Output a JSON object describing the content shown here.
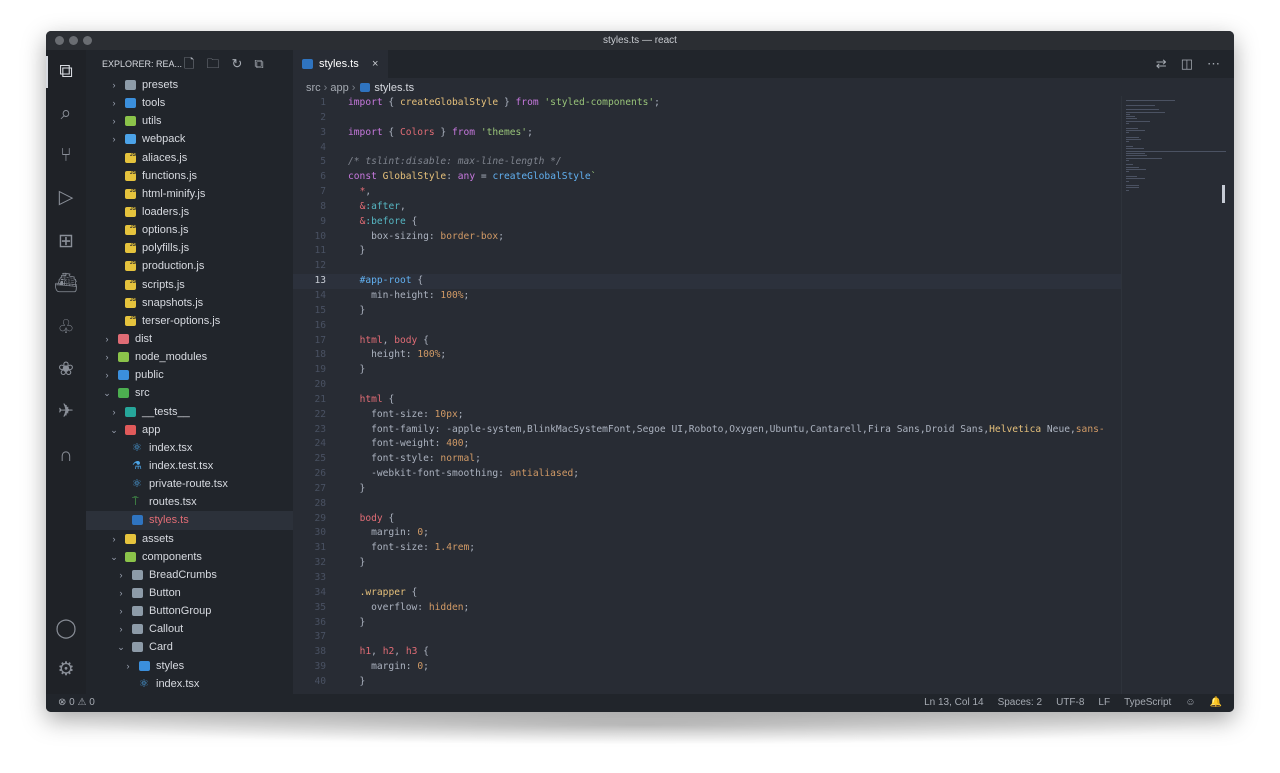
{
  "window": {
    "title": "styles.ts — react"
  },
  "explorer": {
    "title": "EXPLORER: REA...",
    "tree": [
      {
        "label": "presets",
        "kind": "folder",
        "indent": 1,
        "chev": ">",
        "color": "#8d9ba8"
      },
      {
        "label": "tools",
        "kind": "folder",
        "indent": 1,
        "chev": ">",
        "color": "#3b8fdc"
      },
      {
        "label": "utils",
        "kind": "folder",
        "indent": 1,
        "chev": ">",
        "color": "#8bc34a"
      },
      {
        "label": "webpack",
        "kind": "folder",
        "indent": 1,
        "chev": ">",
        "color": "#4ca3e8"
      },
      {
        "label": "aliaces.js",
        "kind": "js",
        "indent": 1
      },
      {
        "label": "functions.js",
        "kind": "js",
        "indent": 1
      },
      {
        "label": "html-minify.js",
        "kind": "js",
        "indent": 1
      },
      {
        "label": "loaders.js",
        "kind": "js",
        "indent": 1
      },
      {
        "label": "options.js",
        "kind": "js",
        "indent": 1
      },
      {
        "label": "polyfills.js",
        "kind": "js",
        "indent": 1
      },
      {
        "label": "production.js",
        "kind": "js",
        "indent": 1
      },
      {
        "label": "scripts.js",
        "kind": "js",
        "indent": 1
      },
      {
        "label": "snapshots.js",
        "kind": "js",
        "indent": 1
      },
      {
        "label": "terser-options.js",
        "kind": "js",
        "indent": 1
      },
      {
        "label": "dist",
        "kind": "folder",
        "indent": 0,
        "chev": ">",
        "color": "#e06c75"
      },
      {
        "label": "node_modules",
        "kind": "folder",
        "indent": 0,
        "chev": ">",
        "color": "#8bc34a"
      },
      {
        "label": "public",
        "kind": "folder",
        "indent": 0,
        "chev": ">",
        "color": "#3b8fdc"
      },
      {
        "label": "src",
        "kind": "folder",
        "indent": 0,
        "chev": "v",
        "color": "#4caf50"
      },
      {
        "label": "__tests__",
        "kind": "folder",
        "indent": 1,
        "chev": ">",
        "color": "#26a69a"
      },
      {
        "label": "app",
        "kind": "folder",
        "indent": 1,
        "chev": "v",
        "color": "#e05a5a"
      },
      {
        "label": "index.tsx",
        "kind": "react",
        "indent": 2
      },
      {
        "label": "index.test.tsx",
        "kind": "test",
        "indent": 2
      },
      {
        "label": "private-route.tsx",
        "kind": "react",
        "indent": 2
      },
      {
        "label": "routes.tsx",
        "kind": "route",
        "indent": 2
      },
      {
        "label": "styles.ts",
        "kind": "ts",
        "indent": 2,
        "selected": true
      },
      {
        "label": "assets",
        "kind": "folder",
        "indent": 1,
        "chev": ">",
        "color": "#e5c33d"
      },
      {
        "label": "components",
        "kind": "folder",
        "indent": 1,
        "chev": "v",
        "color": "#8bc34a"
      },
      {
        "label": "BreadCrumbs",
        "kind": "folder",
        "indent": 2,
        "chev": ">",
        "color": "#8d9ba8"
      },
      {
        "label": "Button",
        "kind": "folder",
        "indent": 2,
        "chev": ">",
        "color": "#8d9ba8"
      },
      {
        "label": "ButtonGroup",
        "kind": "folder",
        "indent": 2,
        "chev": ">",
        "color": "#8d9ba8"
      },
      {
        "label": "Callout",
        "kind": "folder",
        "indent": 2,
        "chev": ">",
        "color": "#8d9ba8"
      },
      {
        "label": "Card",
        "kind": "folder",
        "indent": 2,
        "chev": "v",
        "color": "#8d9ba8"
      },
      {
        "label": "styles",
        "kind": "folder",
        "indent": 3,
        "chev": ">",
        "color": "#3b8fdc"
      },
      {
        "label": "index.tsx",
        "kind": "react",
        "indent": 3
      }
    ]
  },
  "tab": {
    "label": "styles.ts",
    "close": "×"
  },
  "breadcrumb": {
    "parts": [
      "src",
      "app"
    ],
    "file": "styles.ts"
  },
  "code": [
    {
      "n": "1",
      "t": [
        [
          "kw",
          "import"
        ],
        [
          "prop",
          " { "
        ],
        [
          "cls",
          "createGlobalStyle"
        ],
        [
          "prop",
          " } "
        ],
        [
          "kw",
          "from"
        ],
        [
          "prop",
          " "
        ],
        [
          "str",
          "'styled-components'"
        ],
        [
          "prop",
          ";"
        ]
      ]
    },
    {
      "n": "2",
      "t": []
    },
    {
      "n": "3",
      "t": [
        [
          "kw",
          "import"
        ],
        [
          "prop",
          " { "
        ],
        [
          "sel",
          "Colors"
        ],
        [
          "prop",
          " } "
        ],
        [
          "kw",
          "from"
        ],
        [
          "prop",
          " "
        ],
        [
          "str",
          "'themes'"
        ],
        [
          "prop",
          ";"
        ]
      ]
    },
    {
      "n": "4",
      "t": []
    },
    {
      "n": "5",
      "t": [
        [
          "cm",
          "/* tslint:disable: max-line-length */"
        ]
      ]
    },
    {
      "n": "6",
      "t": [
        [
          "kw",
          "const"
        ],
        [
          "prop",
          " "
        ],
        [
          "cls",
          "GlobalStyle"
        ],
        [
          "prop",
          ": "
        ],
        [
          "kw",
          "any"
        ],
        [
          "prop",
          " = "
        ],
        [
          "fn",
          "createGlobalStyle"
        ],
        [
          "str",
          "`"
        ]
      ]
    },
    {
      "n": "7",
      "t": [
        [
          "prop",
          "  "
        ],
        [
          "sel",
          "*"
        ],
        [
          "prop",
          ","
        ]
      ]
    },
    {
      "n": "8",
      "t": [
        [
          "prop",
          "  "
        ],
        [
          "sel",
          "&"
        ],
        [
          "at",
          ":after"
        ],
        [
          "prop",
          ","
        ]
      ]
    },
    {
      "n": "9",
      "t": [
        [
          "prop",
          "  "
        ],
        [
          "sel",
          "&"
        ],
        [
          "at",
          ":before"
        ],
        [
          "prop",
          " {"
        ]
      ]
    },
    {
      "n": "10",
      "t": [
        [
          "prop",
          "    box-sizing: "
        ],
        [
          "val",
          "border-box"
        ],
        [
          "prop",
          ";"
        ]
      ]
    },
    {
      "n": "11",
      "t": [
        [
          "prop",
          "  }"
        ]
      ]
    },
    {
      "n": "12",
      "t": []
    },
    {
      "n": "13",
      "t": [
        [
          "prop",
          "  "
        ],
        [
          "fn",
          "#app-root"
        ],
        [
          "prop",
          " {"
        ]
      ],
      "cur": true
    },
    {
      "n": "14",
      "t": [
        [
          "prop",
          "    min-height: "
        ],
        [
          "num",
          "100%"
        ],
        [
          "prop",
          ";"
        ]
      ]
    },
    {
      "n": "15",
      "t": [
        [
          "prop",
          "  }"
        ]
      ]
    },
    {
      "n": "16",
      "t": []
    },
    {
      "n": "17",
      "t": [
        [
          "prop",
          "  "
        ],
        [
          "sel",
          "html"
        ],
        [
          "prop",
          ", "
        ],
        [
          "sel",
          "body"
        ],
        [
          "prop",
          " {"
        ]
      ]
    },
    {
      "n": "18",
      "t": [
        [
          "prop",
          "    height: "
        ],
        [
          "num",
          "100%"
        ],
        [
          "prop",
          ";"
        ]
      ]
    },
    {
      "n": "19",
      "t": [
        [
          "prop",
          "  }"
        ]
      ]
    },
    {
      "n": "20",
      "t": []
    },
    {
      "n": "21",
      "t": [
        [
          "prop",
          "  "
        ],
        [
          "sel",
          "html"
        ],
        [
          "prop",
          " {"
        ]
      ]
    },
    {
      "n": "22",
      "t": [
        [
          "prop",
          "    font-size: "
        ],
        [
          "num",
          "10px"
        ],
        [
          "prop",
          ";"
        ]
      ]
    },
    {
      "n": "23",
      "t": [
        [
          "prop",
          "    font-family: -apple-system,BlinkMacSystemFont,Segoe UI,Roboto,Oxygen,Ubuntu,Cantarell,Fira Sans,Droid Sans,"
        ],
        [
          "cls",
          "Helvetica"
        ],
        [
          "prop",
          " Neue,"
        ],
        [
          "num",
          "sans-"
        ]
      ]
    },
    {
      "n": "24",
      "t": [
        [
          "prop",
          "    font-weight: "
        ],
        [
          "num",
          "400"
        ],
        [
          "prop",
          ";"
        ]
      ]
    },
    {
      "n": "25",
      "t": [
        [
          "prop",
          "    font-style: "
        ],
        [
          "val",
          "normal"
        ],
        [
          "prop",
          ";"
        ]
      ]
    },
    {
      "n": "26",
      "t": [
        [
          "prop",
          "    -webkit-font-smoothing: "
        ],
        [
          "val",
          "antialiased"
        ],
        [
          "prop",
          ";"
        ]
      ]
    },
    {
      "n": "27",
      "t": [
        [
          "prop",
          "  }"
        ]
      ]
    },
    {
      "n": "28",
      "t": []
    },
    {
      "n": "29",
      "t": [
        [
          "prop",
          "  "
        ],
        [
          "sel",
          "body"
        ],
        [
          "prop",
          " {"
        ]
      ]
    },
    {
      "n": "30",
      "t": [
        [
          "prop",
          "    margin: "
        ],
        [
          "num",
          "0"
        ],
        [
          "prop",
          ";"
        ]
      ]
    },
    {
      "n": "31",
      "t": [
        [
          "prop",
          "    font-size: "
        ],
        [
          "num",
          "1.4rem"
        ],
        [
          "prop",
          ";"
        ]
      ]
    },
    {
      "n": "32",
      "t": [
        [
          "prop",
          "  }"
        ]
      ]
    },
    {
      "n": "33",
      "t": []
    },
    {
      "n": "34",
      "t": [
        [
          "prop",
          "  "
        ],
        [
          "cls",
          ".wrapper"
        ],
        [
          "prop",
          " {"
        ]
      ]
    },
    {
      "n": "35",
      "t": [
        [
          "prop",
          "    overflow: "
        ],
        [
          "val",
          "hidden"
        ],
        [
          "prop",
          ";"
        ]
      ]
    },
    {
      "n": "36",
      "t": [
        [
          "prop",
          "  }"
        ]
      ]
    },
    {
      "n": "37",
      "t": []
    },
    {
      "n": "38",
      "t": [
        [
          "prop",
          "  "
        ],
        [
          "sel",
          "h1"
        ],
        [
          "prop",
          ", "
        ],
        [
          "sel",
          "h2"
        ],
        [
          "prop",
          ", "
        ],
        [
          "sel",
          "h3"
        ],
        [
          "prop",
          " {"
        ]
      ]
    },
    {
      "n": "39",
      "t": [
        [
          "prop",
          "    margin: "
        ],
        [
          "num",
          "0"
        ],
        [
          "prop",
          ";"
        ]
      ]
    },
    {
      "n": "40",
      "t": [
        [
          "prop",
          "  }"
        ]
      ]
    }
  ],
  "status": {
    "problems": "⊗ 0 ⚠ 0",
    "position": "Ln 13, Col 14",
    "spaces": "Spaces: 2",
    "encoding": "UTF-8",
    "eol": "LF",
    "language": "TypeScript"
  },
  "colors": {
    "accent": "#61afef",
    "background": "#282c34",
    "sidebar": "#21252b"
  }
}
